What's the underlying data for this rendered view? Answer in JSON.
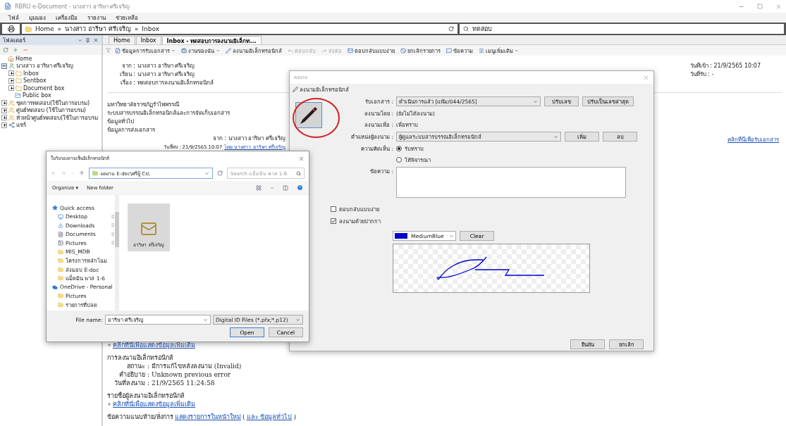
{
  "window": {
    "title": "RBRU e-Document - นางสาว อาริษา ศรีเจริญ"
  },
  "menu": [
    "ไฟล์",
    "มุมมอง",
    "เครื่องมือ",
    "รายงาน",
    "ช่วยเหลือ"
  ],
  "address": {
    "breadcrumb": [
      "Home",
      "นางสาว อาริษา ศรีเจริญ",
      "Inbox"
    ],
    "separator": "»",
    "search": "ทดสอบ"
  },
  "sidebar": {
    "title": "โฟลเดอร์",
    "tree": [
      {
        "label": "Home",
        "kind": "home"
      },
      {
        "label": "นางสาว อาริษา ศรีเจริญ",
        "kind": "user",
        "expanded": true,
        "children": [
          {
            "label": "Inbox",
            "kind": "folder",
            "expanded": false
          },
          {
            "label": "Sentbox",
            "kind": "folder",
            "expanded": false
          },
          {
            "label": "Document box",
            "kind": "folder",
            "expanded": false
          },
          {
            "label": "Public box",
            "kind": "public"
          }
        ]
      },
      {
        "label": "ชุดการทดสอบ(ใช้ในการอบรม)",
        "kind": "group",
        "expanded": false
      },
      {
        "label": "ศูนย์ทดสอบ (ใช้ในการอบรม)",
        "kind": "group",
        "expanded": false
      },
      {
        "label": "หัวหน้าศูนย์ทดสอบ(ใช้ในการอบรม",
        "kind": "group",
        "expanded": false
      },
      {
        "label": "แชร์",
        "kind": "share",
        "expanded": false
      }
    ]
  },
  "tabs": [
    {
      "label": "Home",
      "selected": false
    },
    {
      "label": "Inbox",
      "selected": false
    },
    {
      "label": "Inbox - ทดสอบการลงนามอิเล็กท...",
      "selected": true
    }
  ],
  "toolbar": [
    {
      "label": "ข้อมูลการรับเอกสาร",
      "kind": "dropdown",
      "disabled": false
    },
    {
      "label": "งานของฉัน",
      "kind": "dropdown",
      "disabled": false
    },
    {
      "label": "ลงนามอิเล็กทรอนิกส์",
      "kind": "button",
      "disabled": false
    },
    {
      "label": "ตอบกลับ",
      "kind": "button",
      "disabled": true
    },
    {
      "label": "ส่งต่อ",
      "kind": "button",
      "disabled": true
    },
    {
      "label": "ตอบกลับแบบง่าย",
      "kind": "button",
      "disabled": false
    },
    {
      "label": "ยกเลิกรายการ",
      "kind": "button",
      "disabled": false
    },
    {
      "label": "ข้อความ",
      "kind": "button",
      "disabled": false
    },
    {
      "label": "เมนูเพิ่มเติม",
      "kind": "dropdown",
      "disabled": false
    }
  ],
  "header": [
    {
      "label": "จาก :",
      "value": "นางสาว อาริษา ศรีเจริญ"
    },
    {
      "label": "เรียน :",
      "value": "นางสาว อาริษา ศรีเจริญ"
    },
    {
      "label": "เรื่อง :",
      "value": "ทดสอบการลงนามอิเล็กทรอนิกส์"
    }
  ],
  "dates": [
    "วันที่เข้า : 21/9/2565 10:07",
    "วันที่รับ : -"
  ],
  "receive_link": "คลิกที่นี่เพื่อรับเอกสาร",
  "body": {
    "lines": [
      "มหาวิทยาลัยราชภัฏรำไพพรรณี",
      "ระบบสารบรรณอิเล็กทรอนิกส์และการจัดเก็บเอกสาร",
      "ข้อมูลทั่วไป",
      "ข้อมูลการส่งเอกสาร"
    ],
    "sender": "จาก : นางสาว อาริษา ศรีเจริญ",
    "sent_date": "วันที่ส่ง : 21/9/2565 10:07",
    "sent_by": "โดย นางสาว อาริษา ศรีเจริญ"
  },
  "lower": {
    "more_link": "คลิกที่นี่เพื่อแสดงข้อมูลเพิ่มเติม",
    "signature_title": "การลงนามอิเล็กทรอนิกส์",
    "fields": [
      {
        "label": "สถานะ :",
        "value": "มีการแก้ไขหลังลงนาม (Invalid)"
      },
      {
        "label": "คำอธิบาย :",
        "value": "Unknown previous error"
      },
      {
        "label": "วันที่ลงนาม :",
        "value": "21/9/2565 11:24:58"
      }
    ],
    "signers_title": "รายชื่อผู้ลงนามอิเล็กทรอนิกส์",
    "signers_link": "คลิกที่นี่เพื่อแสดงข้อมูลเพิ่มเติม",
    "attach_label": "ข้อความแนบท้าย/สั่งการ",
    "attach_link": "แสดงรายการในหน้าใหม่",
    "open_paren": "(",
    "general_link": "และ ข้อมูลทั่วไป",
    "close_paren": ")"
  },
  "file_dialog": {
    "title": "ใบรับรองลายเซ็นอิเล็กทรอนิกส์",
    "path": "ผลงาน E-doc\\ศรีผู้ Cs\\",
    "search_placeholder": "Search แม็ดมิน พาส 1-6",
    "organize": "Organize ▾",
    "new_folder": "New folder",
    "nav": [
      {
        "label": "Quick access",
        "kind": "star",
        "pinned": false
      },
      {
        "label": "Desktop",
        "kind": "desktop",
        "pinned": true
      },
      {
        "label": "Downloads",
        "kind": "download",
        "pinned": true
      },
      {
        "label": "Documents",
        "kind": "document",
        "pinned": true
      },
      {
        "label": "Pictures",
        "kind": "pictures",
        "pinned": true
      },
      {
        "label": "MIS_MDB",
        "kind": "folder",
        "pinned": false
      },
      {
        "label": "โครงการหลักโฉม",
        "kind": "folder",
        "pinned": false
      },
      {
        "label": "ส่งมอบ E-doc",
        "kind": "folder",
        "pinned": false
      },
      {
        "label": "แม็ดมิน พาส 1-6",
        "kind": "folder",
        "pinned": false
      },
      {
        "label": "OneDrive - Personal",
        "kind": "cloud",
        "pinned": false
      },
      {
        "label": "Pictures",
        "kind": "folder",
        "pinned": false
      },
      {
        "label": "รายการที่ปลด",
        "kind": "folder",
        "pinned": false
      }
    ],
    "files": [
      {
        "label": "อาริษา ศรีเจริญ",
        "selected": true
      }
    ],
    "file_name_label": "File name:",
    "file_name": "อาริษา ศรีเจริญ",
    "filter": "Digital ID Files (*.pfx;*.p12)",
    "buttons": [
      "Open",
      "Cancel"
    ]
  },
  "sign_dialog": {
    "title": "ลงนาม",
    "heading": "ลงนามอิเล็กทรอนิกส์",
    "receive": {
      "label": "รับเอกสาร :",
      "value": "ดำเนินการแล้ว [แฟ้ม/044/2565]",
      "buttons": [
        "ปรับเลข",
        "ปรับเป็นเลขล่าสุด"
      ]
    },
    "signed_by": {
      "label": "ลงนามโดย :",
      "value": "(ยังไม่ได้ลงนาม)"
    },
    "purpose": {
      "label": "ลงนามเพื่อ :",
      "value": "เพื่อทราบ"
    },
    "position": {
      "label": "ตำแหน่งผู้ลงนาม :",
      "value": "ผู้ดูแลระบบสารบรรณอิเล็กทรอนิกส์",
      "buttons": [
        "เพิ่ม",
        "ลบ"
      ]
    },
    "opinion": {
      "label": "ความคิดเห็น :",
      "options": [
        {
          "label": "รับทราบ",
          "selected": true
        },
        {
          "label": "ให้พิจารณา",
          "selected": false
        }
      ]
    },
    "message": {
      "label": "ข้อความ :"
    },
    "checks": [
      {
        "label": "ตอบกลับแบบง่าย",
        "checked": false
      },
      {
        "label": "ลงนามด้วยปากกา",
        "checked": true
      }
    ],
    "pen_color": {
      "name": "MediumBlue",
      "color": "#0000cd"
    },
    "clear": "Clear",
    "buttons": [
      "ยืนยัน",
      "ยกเลิก"
    ]
  }
}
